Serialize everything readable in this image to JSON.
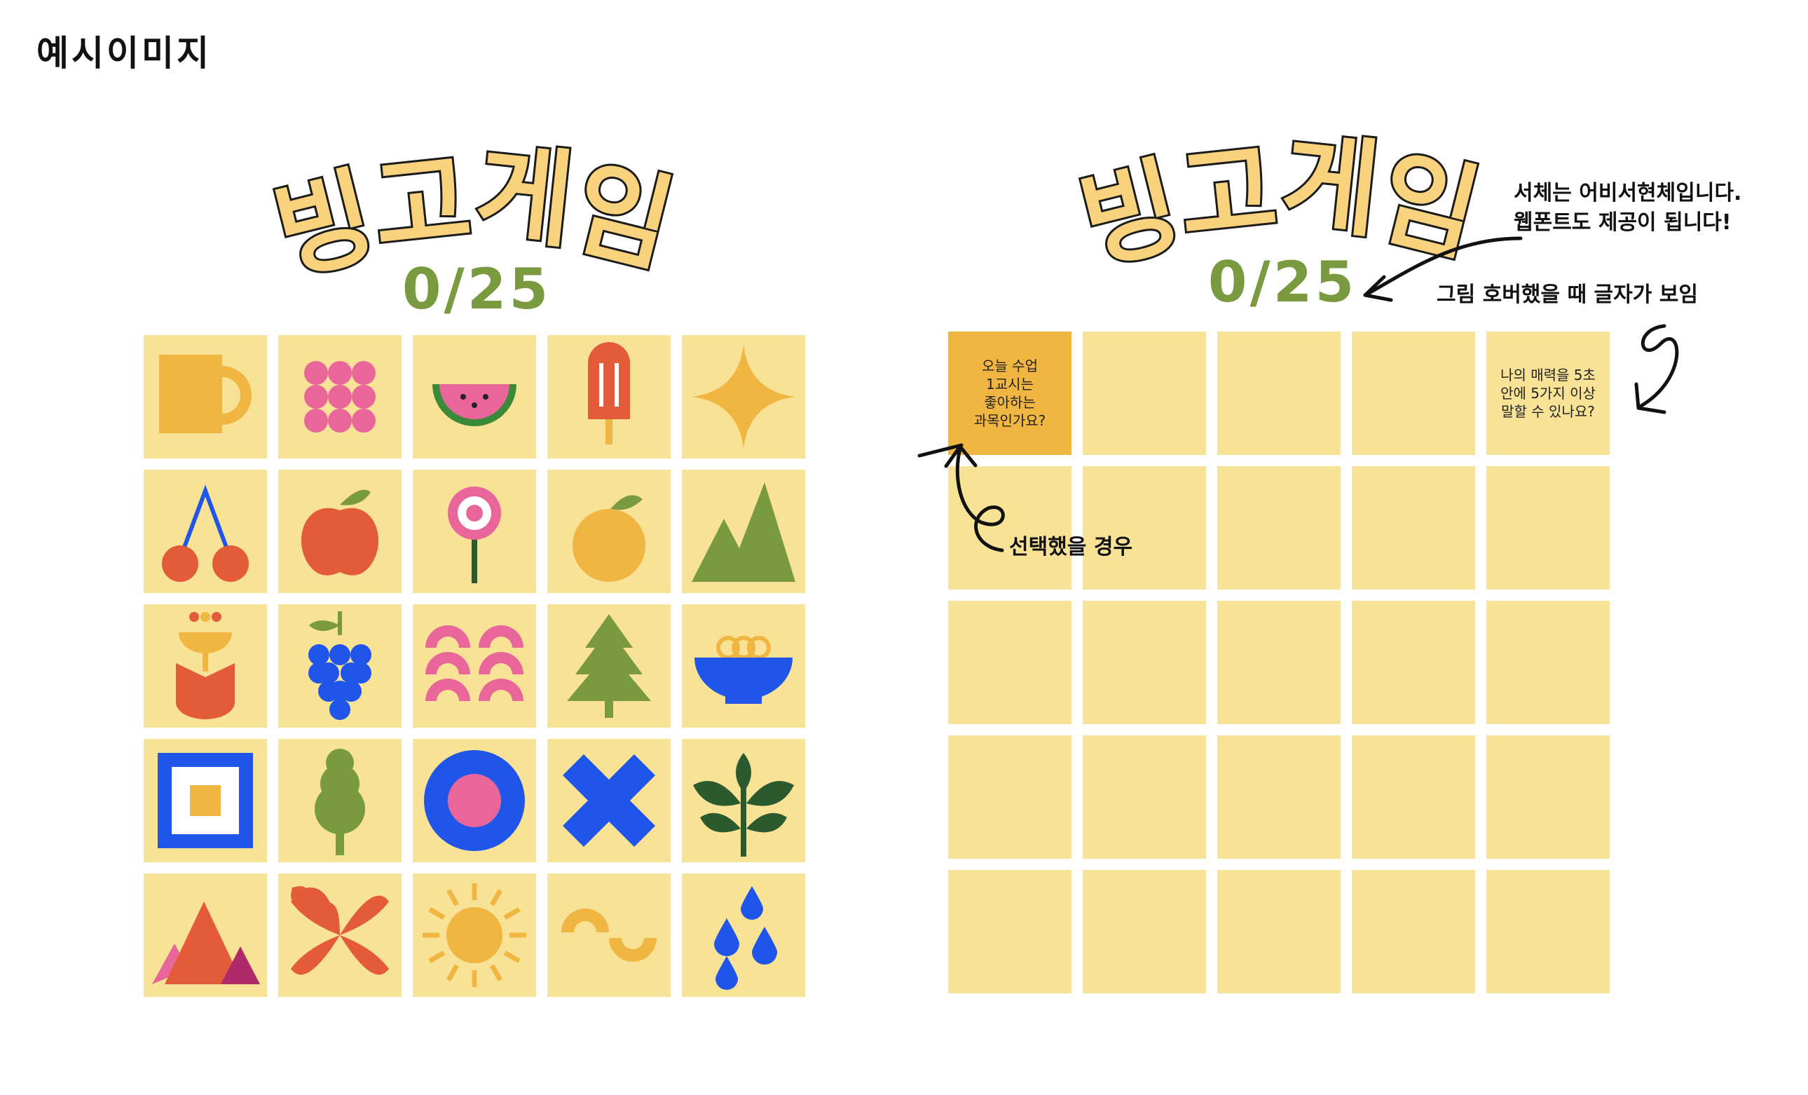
{
  "caption": "예시이미지",
  "left_board": {
    "title_chars": [
      "빙",
      "고",
      "게",
      "임"
    ],
    "score": "0/25",
    "icons": [
      "mug-icon",
      "dots-icon",
      "watermelon-icon",
      "popsicle-icon",
      "sparkle-icon",
      "cherry-icon",
      "apple-icon",
      "lollipop-icon",
      "orange-icon",
      "mountains-icon",
      "tulip-icon",
      "grapes-icon",
      "arches-icon",
      "tree-icon",
      "bowl-icon",
      "square-frame-icon",
      "bush-icon",
      "donut-icon",
      "cross-icon",
      "leaves-icon",
      "peaks-icon",
      "petals-icon",
      "sun-icon",
      "wave-icon",
      "drops-icon"
    ]
  },
  "right_board": {
    "title_chars": [
      "빙",
      "고",
      "게",
      "임"
    ],
    "score": "0/25",
    "selected_tile_text": "오늘 수업\n1교시는\n좋아하는\n과목인가요?",
    "hover_tile_text": "나의 매력을 5초\n안에 5가지 이상\n말할 수 있나요?"
  },
  "annotations": {
    "font_note_line1": "서체는 어비서현체입니다.",
    "font_note_line2": "웹폰트도 제공이 됩니다!",
    "hover_note": "그림 호버했을 때 글자가 보임",
    "selected_note": "선택했을 경우"
  },
  "colors": {
    "tile": "#f7e295",
    "tile_selected": "#f0b641",
    "score": "#7a9a3f",
    "title_fill": "#f9d27e"
  }
}
